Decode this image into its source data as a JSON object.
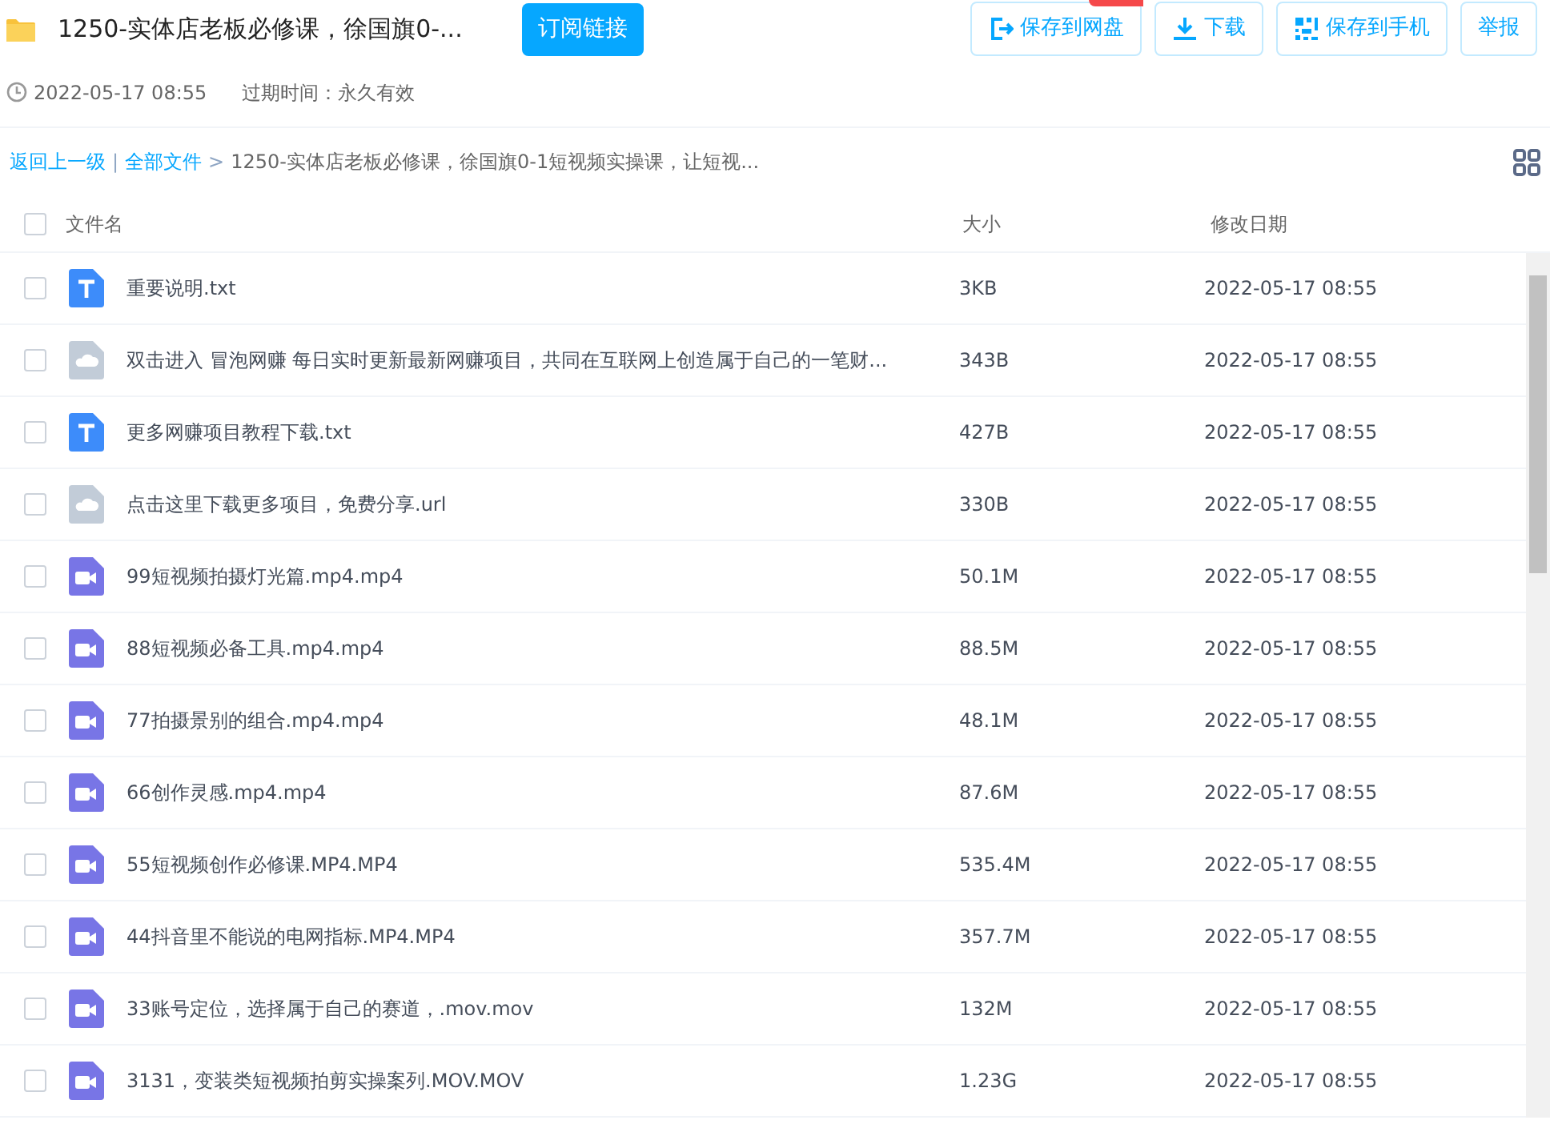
{
  "share": {
    "title": "1250-实体店老板必修课，徐国旗0-...",
    "subscribe_button": "订阅链接",
    "date": "2022-05-17 08:55",
    "expiry": "过期时间：永久有效"
  },
  "actions": [
    {
      "kind": "save",
      "label": "保存到网盘",
      "badge": true
    },
    {
      "kind": "download",
      "label": "下载",
      "badge": false
    },
    {
      "kind": "phone",
      "label": "保存到手机",
      "badge": false
    },
    {
      "kind": "report",
      "label": "举报",
      "badge": false
    }
  ],
  "breadcrumb": {
    "back": "返回上一级",
    "root": "全部文件",
    "separator": "|",
    "arrow": ">",
    "current": "1250-实体店老板必修课，徐国旗0-1短视频实操课，让短视..."
  },
  "table": {
    "columns": [
      "文件名",
      "大小",
      "修改日期"
    ],
    "all_checked": false,
    "rows": [
      {
        "kind": "text",
        "name": "重要说明.txt",
        "size": "3KB",
        "date": "2022-05-17 08:55",
        "checked": false
      },
      {
        "kind": "cloud",
        "name": "双击进入 冒泡网赚 每日实时更新最新网赚项目，共同在互联网上创造属于自己的一笔财...",
        "size": "343B",
        "date": "2022-05-17 08:55",
        "checked": false
      },
      {
        "kind": "text",
        "name": "更多网赚项目教程下载.txt",
        "size": "427B",
        "date": "2022-05-17 08:55",
        "checked": false
      },
      {
        "kind": "cloud",
        "name": "点击这里下载更多项目，免费分享.url",
        "size": "330B",
        "date": "2022-05-17 08:55",
        "checked": false
      },
      {
        "kind": "video",
        "name": "99短视频拍摄灯光篇.mp4.mp4",
        "size": "50.1M",
        "date": "2022-05-17 08:55",
        "checked": false
      },
      {
        "kind": "video",
        "name": "88短视频必备工具.mp4.mp4",
        "size": "88.5M",
        "date": "2022-05-17 08:55",
        "checked": false
      },
      {
        "kind": "video",
        "name": "77拍摄景别的组合.mp4.mp4",
        "size": "48.1M",
        "date": "2022-05-17 08:55",
        "checked": false
      },
      {
        "kind": "video",
        "name": "66创作灵感.mp4.mp4",
        "size": "87.6M",
        "date": "2022-05-17 08:55",
        "checked": false
      },
      {
        "kind": "video",
        "name": "55短视频创作必修课.MP4.MP4",
        "size": "535.4M",
        "date": "2022-05-17 08:55",
        "checked": false
      },
      {
        "kind": "video",
        "name": "44抖音里不能说的电网指标.MP4.MP4",
        "size": "357.7M",
        "date": "2022-05-17 08:55",
        "checked": false
      },
      {
        "kind": "video",
        "name": "33账号定位，选择属于自己的赛道，.mov.mov",
        "size": "132M",
        "date": "2022-05-17 08:55",
        "checked": false
      },
      {
        "kind": "video",
        "name": "3131，变装类短视频拍剪实操案列.MOV.MOV",
        "size": "1.23G",
        "date": "2022-05-17 08:55",
        "checked": false
      }
    ]
  }
}
